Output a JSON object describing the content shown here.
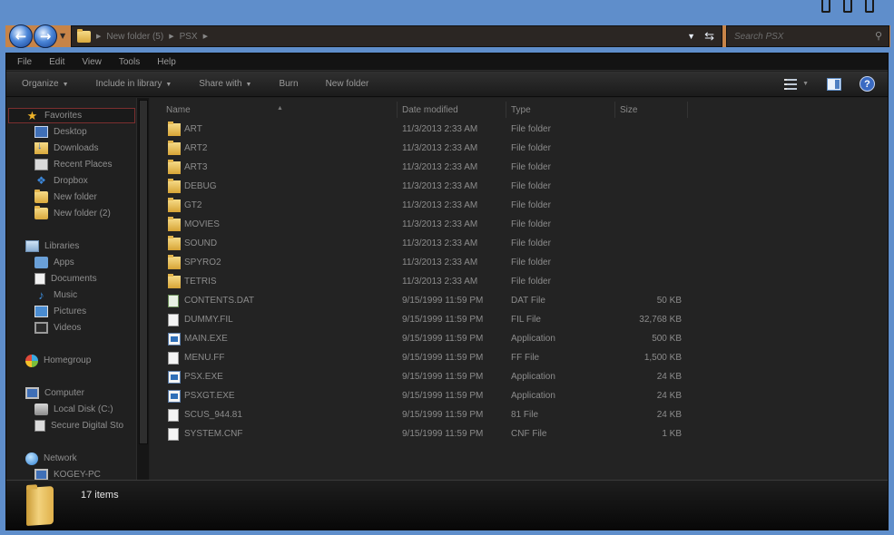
{
  "window_controls": [
    "minimize",
    "maximize",
    "close"
  ],
  "address_bar": {
    "segments": [
      "New folder (5)",
      "PSX"
    ],
    "dropdown_icon": "chevron-down-icon",
    "refresh_icon": "refresh-icon"
  },
  "search": {
    "placeholder": "Search PSX"
  },
  "menu": {
    "file": "File",
    "edit": "Edit",
    "view": "View",
    "tools": "Tools",
    "help": "Help"
  },
  "toolbar": {
    "organize": "Organize",
    "include_in_library": "Include in library",
    "share_with": "Share with",
    "burn": "Burn",
    "new_folder": "New folder"
  },
  "sidebar": {
    "favorites": {
      "label": "Favorites",
      "items": [
        "Desktop",
        "Downloads",
        "Recent Places",
        "Dropbox",
        "New folder",
        "New folder (2)"
      ]
    },
    "libraries": {
      "label": "Libraries",
      "items": [
        "Apps",
        "Documents",
        "Music",
        "Pictures",
        "Videos"
      ]
    },
    "homegroup": "Homegroup",
    "computer": {
      "label": "Computer",
      "items": [
        "Local Disk (C:)",
        "Secure Digital Sto"
      ]
    },
    "network": {
      "label": "Network",
      "items": [
        "KOGEY-PC"
      ]
    }
  },
  "columns": {
    "name": "Name",
    "date": "Date modified",
    "type": "Type",
    "size": "Size"
  },
  "files": [
    {
      "name": "ART",
      "date": "11/3/2013 2:33 AM",
      "type": "File folder",
      "size": "",
      "icon": "folder"
    },
    {
      "name": "ART2",
      "date": "11/3/2013 2:33 AM",
      "type": "File folder",
      "size": "",
      "icon": "folder"
    },
    {
      "name": "ART3",
      "date": "11/3/2013 2:33 AM",
      "type": "File folder",
      "size": "",
      "icon": "folder"
    },
    {
      "name": "DEBUG",
      "date": "11/3/2013 2:33 AM",
      "type": "File folder",
      "size": "",
      "icon": "folder"
    },
    {
      "name": "GT2",
      "date": "11/3/2013 2:33 AM",
      "type": "File folder",
      "size": "",
      "icon": "folder"
    },
    {
      "name": "MOVIES",
      "date": "11/3/2013 2:33 AM",
      "type": "File folder",
      "size": "",
      "icon": "folder"
    },
    {
      "name": "SOUND",
      "date": "11/3/2013 2:33 AM",
      "type": "File folder",
      "size": "",
      "icon": "folder"
    },
    {
      "name": "SPYRO2",
      "date": "11/3/2013 2:33 AM",
      "type": "File folder",
      "size": "",
      "icon": "folder"
    },
    {
      "name": "TETRIS",
      "date": "11/3/2013 2:33 AM",
      "type": "File folder",
      "size": "",
      "icon": "folder"
    },
    {
      "name": "CONTENTS.DAT",
      "date": "9/15/1999 11:59 PM",
      "type": "DAT File",
      "size": "50 KB",
      "icon": "dat"
    },
    {
      "name": "DUMMY.FIL",
      "date": "9/15/1999 11:59 PM",
      "type": "FIL File",
      "size": "32,768 KB",
      "icon": "file"
    },
    {
      "name": "MAIN.EXE",
      "date": "9/15/1999 11:59 PM",
      "type": "Application",
      "size": "500 KB",
      "icon": "app"
    },
    {
      "name": "MENU.FF",
      "date": "9/15/1999 11:59 PM",
      "type": "FF File",
      "size": "1,500 KB",
      "icon": "file"
    },
    {
      "name": "PSX.EXE",
      "date": "9/15/1999 11:59 PM",
      "type": "Application",
      "size": "24 KB",
      "icon": "app"
    },
    {
      "name": "PSXGT.EXE",
      "date": "9/15/1999 11:59 PM",
      "type": "Application",
      "size": "24 KB",
      "icon": "app"
    },
    {
      "name": "SCUS_944.81",
      "date": "9/15/1999 11:59 PM",
      "type": "81 File",
      "size": "24 KB",
      "icon": "file"
    },
    {
      "name": "SYSTEM.CNF",
      "date": "9/15/1999 11:59 PM",
      "type": "CNF File",
      "size": "1 KB",
      "icon": "file"
    }
  ],
  "status": {
    "count": "17 items"
  },
  "colors": {
    "desktop": "#5f8ecb",
    "nav_strip": "#c78448",
    "window_bg": "#202020",
    "selection_border": "#7c2f2f"
  }
}
